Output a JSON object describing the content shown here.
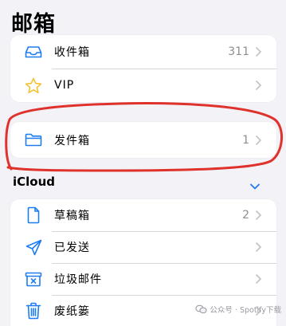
{
  "header": {
    "title": "邮箱"
  },
  "mailboxes": [
    {
      "label": "收件箱",
      "count": "311",
      "icon": "inbox-tray-icon"
    },
    {
      "label": "VIP",
      "count": "",
      "icon": "star-icon"
    }
  ],
  "sent": {
    "label": "发件箱",
    "count": "1",
    "icon": "folder-icon"
  },
  "icloud": {
    "title": "iCloud",
    "items": [
      {
        "label": "草稿箱",
        "count": "2",
        "icon": "document-icon"
      },
      {
        "label": "已发送",
        "count": "",
        "icon": "paper-plane-icon"
      },
      {
        "label": "垃圾邮件",
        "count": "",
        "icon": "junk-tray-icon"
      },
      {
        "label": "废纸篓",
        "count": "",
        "icon": "trash-icon"
      }
    ]
  },
  "watermark": {
    "text": "公众号 · Spotify下载"
  },
  "colors": {
    "accent": "#1e7cf2",
    "annotation": "#e0322d",
    "secondary_text": "#8e8e93"
  }
}
